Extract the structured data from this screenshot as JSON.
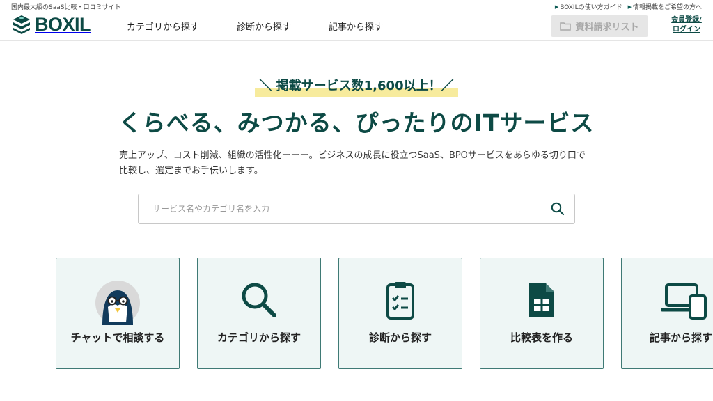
{
  "header": {
    "tagline": "国内最大級のSaaS比較・口コミサイト",
    "top_links": [
      "BOXILの使い方ガイド",
      "情報掲載をご希望の方へ"
    ],
    "logo_text": "BOXIL",
    "nav": [
      "カテゴリから探す",
      "診断から探す",
      "記事から探す"
    ],
    "doc_list_label": "資料請求リスト",
    "login_label_line1": "会員登録/",
    "login_label_line2": "ログイン"
  },
  "hero": {
    "badge": "＼ 掲載サービス数1,600以上！／",
    "title": "くらべる、みつかる、ぴったりのITサービス",
    "description_line1": "売上アップ、コスト削減、組織の活性化ーーー。ビジネスの成長に役立つSaaS、BPOサービスをあらゆる切り口で",
    "description_line2": "比較し、選定までお手伝いします。"
  },
  "search": {
    "placeholder": "サービス名やカテゴリ名を入力",
    "value": ""
  },
  "cards": [
    {
      "label": "チャットで相談する",
      "icon": "penguin-avatar"
    },
    {
      "label": "カテゴリから探す",
      "icon": "magnifier-icon"
    },
    {
      "label": "診断から探す",
      "icon": "clipboard-checklist-icon"
    },
    {
      "label": "比較表を作る",
      "icon": "spreadsheet-file-icon"
    },
    {
      "label": "記事から探す",
      "icon": "devices-icon"
    }
  ],
  "colors": {
    "brand": "#0d4a45",
    "card_bg": "#eef6f5",
    "card_border": "#3f7a75",
    "highlight": "#f7eb9d",
    "disabled_button": "#e6e6e6"
  }
}
